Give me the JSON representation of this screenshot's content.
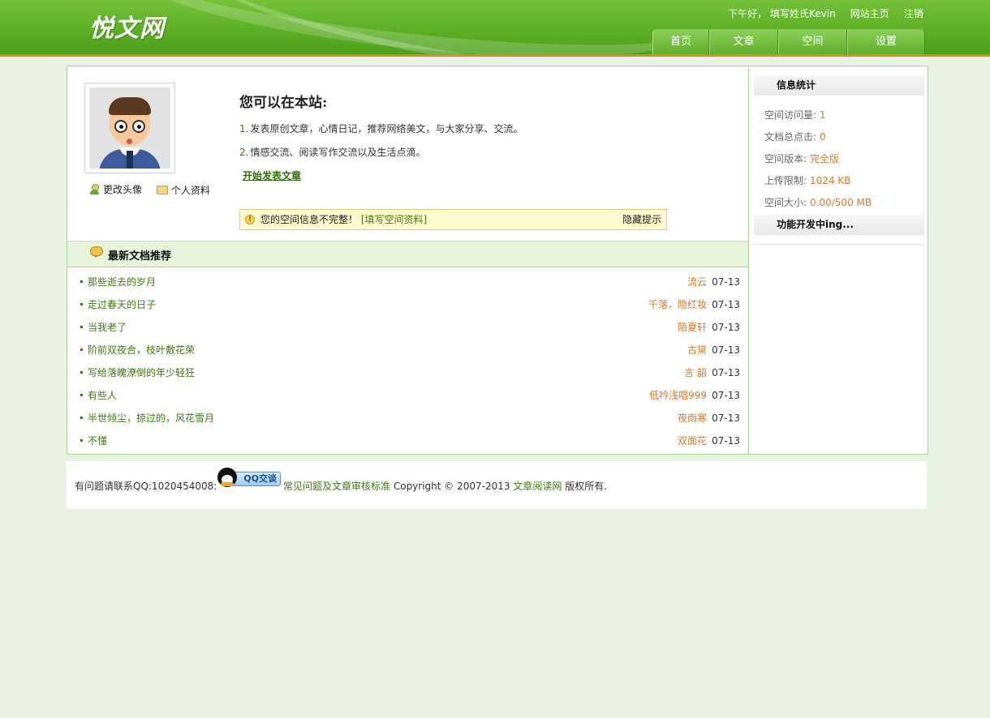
{
  "header": {
    "logo": "悦文网",
    "greeting": "下午好，",
    "username": "填写姓氏Kevin",
    "home_link": "网站主页",
    "logout_link": "注销",
    "nav": [
      {
        "label": "首页"
      },
      {
        "label": "文章"
      },
      {
        "label": "空间"
      },
      {
        "label": "设置"
      }
    ]
  },
  "profile": {
    "change_avatar": "更改头像",
    "personal_info": "个人资料"
  },
  "intro": {
    "title": "您可以在本站:",
    "item1_num": "1.",
    "item1": "发表原创文章，心情日记，推荐网络美文，与大家分享、交流。",
    "item2_num": "2.",
    "item2": "情感交流、阅读写作交流以及生活点滴。",
    "start_link": "开始发表文章"
  },
  "notice": {
    "message": "您的空间信息不完整！",
    "fill_link": "[填写空间资料]",
    "hide_link": "隐藏提示"
  },
  "latest": {
    "title": "最新文档推荐",
    "articles": [
      {
        "title": "那些逝去的岁月",
        "author": "流云",
        "date": "07-13"
      },
      {
        "title": "走过春天的日子",
        "author": "千落，隐红妆",
        "date": "07-13"
      },
      {
        "title": "当我老了",
        "author": "陌夏轩",
        "date": "07-13"
      },
      {
        "title": "阶前双夜合，枝叶敷花荣",
        "author": "古黛",
        "date": "07-13"
      },
      {
        "title": "写给落魄潦倒的年少轻狂",
        "author": "言 韶",
        "date": "07-13"
      },
      {
        "title": "有些人",
        "author": "低吟浅唱999",
        "date": "07-13"
      },
      {
        "title": "半世倾尘，掠过的，风花雪月",
        "author": "夜雨寒",
        "date": "07-13"
      },
      {
        "title": "不懂",
        "author": "双面花",
        "date": "07-13"
      }
    ]
  },
  "sidebar": {
    "stats_title": "信息统计",
    "stats": [
      {
        "label": "空间访问量:",
        "value": "1"
      },
      {
        "label": "文档总点击:",
        "value": "0"
      },
      {
        "label": "空间版本:",
        "value": "完全版"
      },
      {
        "label": "上传限制:",
        "value": "1024 KB"
      },
      {
        "label": "空间大小:",
        "value": "0.00/500 MB"
      }
    ],
    "dev_title": "功能开发中ing..."
  },
  "footer": {
    "contact": "有问题请联系QQ:1020454008:",
    "qq_button": "QQ交谈",
    "faq_link": "常见问题及文章审核标准",
    "copyright": "Copyright © 2007-2013",
    "site_link": "文章阅读网",
    "rights": "版权所有."
  },
  "colors": {
    "header_green": "#5cae25",
    "link_green": "#3d7a11",
    "accent_orange": "#d8792a",
    "page_bg": "#eaf2e4"
  }
}
